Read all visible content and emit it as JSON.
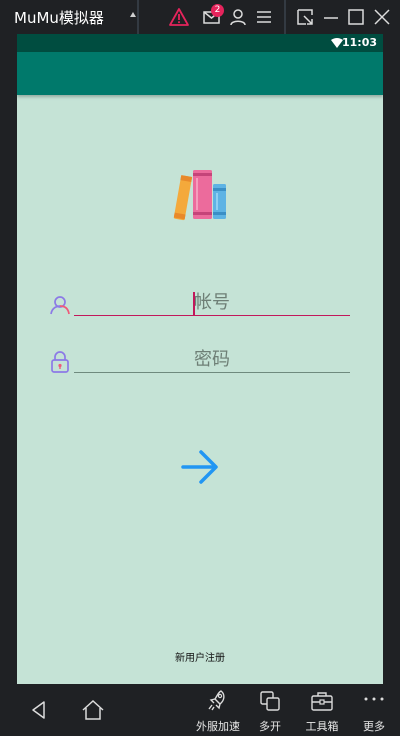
{
  "window": {
    "title": "MuMu模拟器",
    "notification_count": "2",
    "icons": [
      "caret-up-icon",
      "warning-icon",
      "mail-icon",
      "user-icon",
      "menu-icon",
      "screen-pop-icon",
      "minimize-icon",
      "maximize-icon",
      "close-icon"
    ]
  },
  "status_bar": {
    "time": "11:03"
  },
  "login": {
    "account_placeholder": "帐号",
    "password_placeholder": "密码",
    "register_label": "新用户注册"
  },
  "toolbar": {
    "accelerate_label": "外服加速",
    "multi_label": "多开",
    "toolbox_label": "工具箱",
    "more_label": "更多"
  },
  "colors": {
    "screen_bg": "#c5e3d6",
    "status_bar": "#004d40",
    "app_bar": "#00796b",
    "accent": "#c2185b",
    "arrow": "#2196f3",
    "icon_purple": "#8c7ae6"
  }
}
